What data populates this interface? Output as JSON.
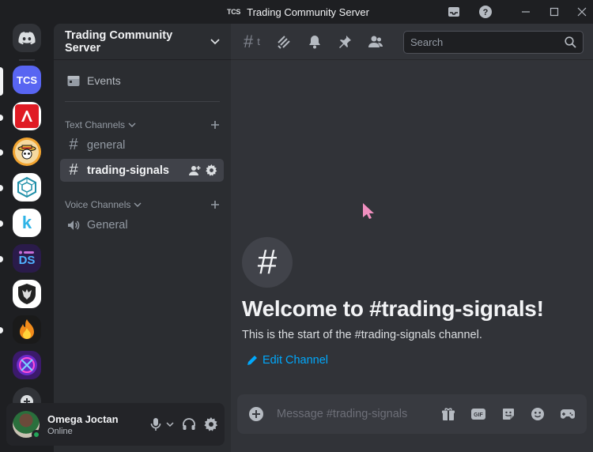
{
  "window": {
    "badge": "TCS",
    "title": "Trading Community Server"
  },
  "rail": {
    "servers": [
      {
        "name": "discord-home"
      },
      {
        "name": "TCS",
        "label": "TCS"
      },
      {
        "name": "red-logo-server"
      },
      {
        "name": "one-piece-server"
      },
      {
        "name": "cube-server"
      },
      {
        "name": "k-server",
        "label": "k"
      },
      {
        "name": "ds-server",
        "label": "DS"
      },
      {
        "name": "shield-server"
      },
      {
        "name": "fire-server"
      },
      {
        "name": "purple-server"
      }
    ]
  },
  "sidebar": {
    "server_name": "Trading Community Server",
    "events_label": "Events",
    "text_category": "Text Channels",
    "voice_category": "Voice Channels",
    "channels": [
      {
        "name": "general",
        "type": "text"
      },
      {
        "name": "trading-signals",
        "type": "text",
        "active": true
      },
      {
        "name": "General",
        "type": "voice"
      }
    ]
  },
  "user": {
    "name": "Omega Joctan",
    "status": "Online"
  },
  "main": {
    "header_hash": "#",
    "header_extra": "t",
    "search_placeholder": "Search",
    "welcome_title": "Welcome to #trading-signals!",
    "welcome_sub": "This is the start of the #trading-signals channel.",
    "edit_channel": "Edit Channel",
    "composer_placeholder": "Message #trading-signals"
  },
  "colors": {
    "accent": "#5865f2",
    "link": "#00a8fc",
    "online": "#23a559"
  }
}
